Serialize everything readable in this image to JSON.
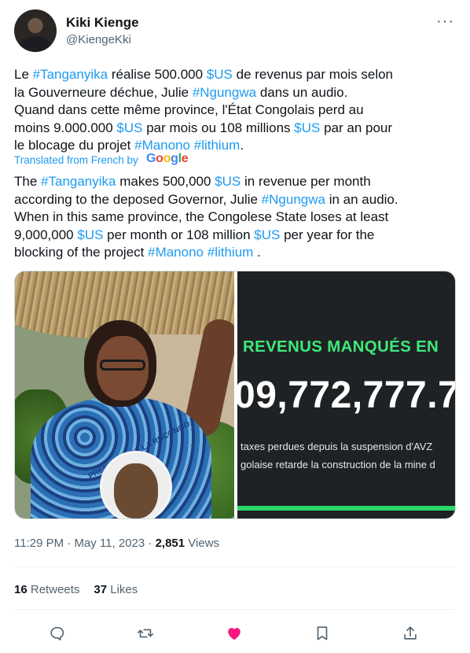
{
  "author": {
    "name": "Kiki Kienge",
    "handle": "@KiengeKki"
  },
  "original_text": {
    "l1": [
      "Le ",
      "#Tanganyika",
      " réalise 500.000 ",
      "$US",
      " de revenus par mois selon"
    ],
    "l2": [
      "la Gouverneure déchue, Julie ",
      "#Ngungwa",
      " dans un audio."
    ],
    "l3": [
      "Quand dans cette même province, l'État Congolais perd au"
    ],
    "l4": [
      "moins 9.000.000 ",
      "$US",
      " par mois ou 108 millions ",
      "$US",
      " par an pour"
    ],
    "l5": [
      "le blocage du projet ",
      "#Manono",
      " ",
      "#lithium",
      "."
    ]
  },
  "translated_label": "Translated from French by",
  "google_logo": "Google",
  "translated_text": {
    "l1": [
      "The ",
      "#Tanganyika",
      " makes 500,000 ",
      "$US",
      " in revenue per month"
    ],
    "l2": [
      "according to the deposed Governor, Julie ",
      "#Ngungwa",
      " in an audio."
    ],
    "l3": [
      "When in this same province, the Congolese State loses at least"
    ],
    "l4": [
      "9,000,000 ",
      "$US",
      " per month or 108 million ",
      "$US",
      " per year for the"
    ],
    "l5": [
      "blocking of the project ",
      "#Manono",
      " ",
      "#lithium",
      " ."
    ]
  },
  "media": {
    "left_photo_dress_text": "PRESIDENT DE LA RDCONGO",
    "right": {
      "title": "REVENUS MANQUÉS EN",
      "number": "09,772,777.7",
      "sub1": "taxes perdues depuis la suspension d'AVZ",
      "sub2": "golaise retarde la construction de la mine d"
    }
  },
  "meta": {
    "time": "11:29 PM",
    "date": "May 11, 2023",
    "views_count": "2,851",
    "views_label": "Views"
  },
  "stats": {
    "retweets_count": "16",
    "retweets_label": "Retweets",
    "likes_count": "37",
    "likes_label": "Likes"
  },
  "icons": {
    "reply": "reply-icon",
    "retweet": "retweet-icon",
    "like": "heart-icon",
    "bookmark": "bookmark-icon",
    "share": "share-icon",
    "more": "more-icon"
  },
  "colors": {
    "link": "#1d9bf0",
    "heart": "#f91880",
    "muted": "#536471",
    "revenue_green": "#3ee87a"
  }
}
